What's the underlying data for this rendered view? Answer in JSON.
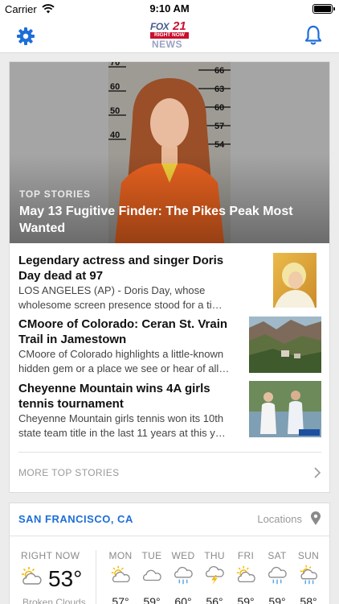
{
  "status_bar": {
    "carrier": "Carrier",
    "time": "9:10 AM"
  },
  "header": {
    "logo": {
      "line1": "FOX",
      "line2": "21",
      "bar": "RIGHT NOW",
      "line3": "NEWS"
    }
  },
  "top_stories": {
    "hero": {
      "kicker": "TOP STORIES",
      "headline": "May 13 Fugitive Finder: The Pikes Peak Most Wanted",
      "height_marks": [
        "70",
        "60",
        "50",
        "40",
        "66",
        "63",
        "60",
        "57",
        "54"
      ]
    },
    "stories": [
      {
        "title": "Legendary actress and singer Doris Day dead at 97",
        "desc": "LOS ANGELES (AP) - Doris Day, whose wholesome screen presence stood for a ti…"
      },
      {
        "title": "CMoore of Colorado: Ceran St. Vrain Trail in Jamestown",
        "desc": "CMoore of Colorado highlights a little-known hidden gem or a place we see or hear of all…"
      },
      {
        "title": "Cheyenne Mountain wins 4A girls tennis tournament",
        "desc": "Cheyenne Mountain girls tennis won its 10th state team title in the last 11 years at this y…"
      }
    ],
    "more_label": "MORE TOP STORIES"
  },
  "weather": {
    "city": "SAN FRANCISCO, CA",
    "locations_label": "Locations",
    "now": {
      "label": "RIGHT NOW",
      "temp": "53°",
      "condition": "Broken Clouds",
      "icon": "partly-cloudy-icon"
    },
    "forecast": [
      {
        "day": "MON",
        "temp": "57°",
        "icon": "partly-cloudy-icon"
      },
      {
        "day": "TUE",
        "temp": "59°",
        "icon": "cloud-icon"
      },
      {
        "day": "WED",
        "temp": "60°",
        "icon": "rain-icon"
      },
      {
        "day": "THU",
        "temp": "56°",
        "icon": "thunderstorm-icon"
      },
      {
        "day": "FRI",
        "temp": "59°",
        "icon": "partly-cloudy-icon"
      },
      {
        "day": "SAT",
        "temp": "59°",
        "icon": "rain-icon"
      },
      {
        "day": "SUN",
        "temp": "58°",
        "icon": "sun-rain-icon"
      }
    ]
  },
  "colors": {
    "accent": "#1d6ed8",
    "brand_red": "#c8102e",
    "sun": "#f5b800"
  }
}
